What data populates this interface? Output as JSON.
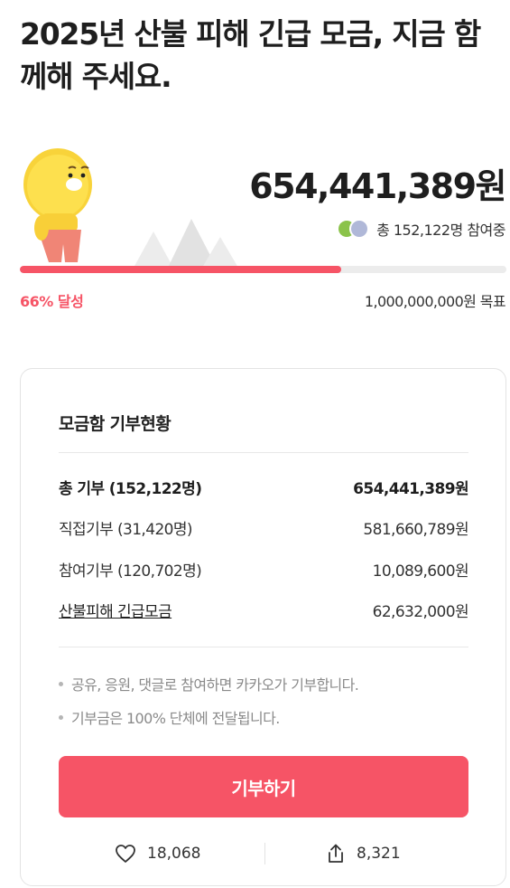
{
  "page": {
    "title": "2025년 산불 피해 긴급 모금, 지금 함께해 주세요."
  },
  "summary": {
    "amount": "654,441,389원",
    "participants_text": "총 152,122명 참여중",
    "progress_ratio": 0.66,
    "percent_text": "66% 달성",
    "goal_text": "1,000,000,000원 목표"
  },
  "donation_status": {
    "title": "모금함 기부현황",
    "rows": [
      {
        "label": "총 기부 (152,122명)",
        "value": "654,441,389원"
      },
      {
        "label": "직접기부 (31,420명)",
        "value": "581,660,789원"
      },
      {
        "label": "참여기부 (120,702명)",
        "value": "10,089,600원"
      },
      {
        "label": "산불피해 긴급모금",
        "value": "62,632,000원"
      }
    ],
    "notes": [
      "공유, 응원, 댓글로 참여하면 카카오가 기부합니다.",
      "기부금은 100% 단체에 전달됩니다."
    ],
    "donate_label": "기부하기",
    "like_count": "18,068",
    "share_count": "8,321"
  },
  "colors": {
    "accent": "#f65466",
    "track": "#ececec"
  },
  "icons": {
    "like": "heart-icon",
    "share": "share-icon",
    "mascot": "mascot-illustration"
  }
}
